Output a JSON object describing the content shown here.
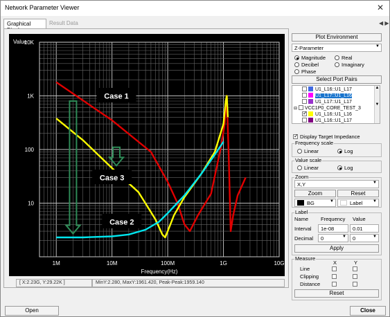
{
  "window": {
    "title": "Network Parameter Viewer",
    "close_glyph": "✕"
  },
  "tabs": [
    {
      "label": "Graphical Display",
      "active": true
    },
    {
      "label": "Result Data",
      "active": false
    }
  ],
  "tab_nav": "◀ ▶",
  "chart_data": {
    "type": "line",
    "ylabel": "Value",
    "xlabel": "Frequency(Hz)",
    "x_scale": "log",
    "y_scale": "log",
    "xlim": [
      500000,
      10000000000
    ],
    "ylim": [
      1,
      10000
    ],
    "x_ticks": [
      "1M",
      "10M",
      "100M",
      "1G",
      "10G"
    ],
    "y_ticks": [
      "10K",
      "1K",
      "100",
      "10"
    ],
    "grid": true,
    "series": [
      {
        "color": "#e00000",
        "x": [
          1000000,
          10000000,
          50000000,
          100000000,
          150000000,
          200000000,
          250000000,
          350000000,
          600000000,
          900000000,
          1050000000,
          1150000000,
          1250000000,
          1350000000,
          1500000000,
          1800000000,
          2500000000
        ],
        "y": [
          1800,
          350,
          90,
          25,
          10,
          4,
          3,
          6,
          15,
          110,
          300,
          1000,
          60,
          3,
          6,
          14,
          30
        ]
      },
      {
        "color": "#ffff00",
        "x": [
          1000000,
          3000000,
          10000000,
          30000000,
          60000000,
          80000000,
          90000000,
          100000000,
          130000000,
          200000000,
          400000000,
          700000000,
          1000000000,
          1100000000,
          1150000000,
          1200000000
        ],
        "y": [
          380,
          150,
          45,
          16,
          5,
          2.6,
          2.3,
          3,
          6,
          13,
          35,
          90,
          300,
          800,
          1000,
          400
        ]
      },
      {
        "color": "#00e5ee",
        "x": [
          1000000,
          3000000,
          10000000,
          20000000,
          40000000,
          70000000,
          100000000,
          200000000,
          400000000,
          700000000,
          1000000000
        ],
        "y": [
          2.3,
          2.3,
          2.4,
          2.6,
          3.2,
          4.5,
          6.5,
          14,
          35,
          80,
          140
        ]
      }
    ],
    "annotations": [
      {
        "text": "Case 1",
        "x": 12000000,
        "y": 1000
      },
      {
        "text": "Case 3",
        "x": 10000000,
        "y": 30
      },
      {
        "text": "Case 2",
        "x": 15000000,
        "y": 4.5
      }
    ],
    "arrows": [
      {
        "x": 2000000,
        "y_from": 800,
        "y_to": 2.7
      },
      {
        "x": 12000000,
        "y_from": 110,
        "y_to": 50
      }
    ]
  },
  "status": {
    "coords": "[ X:2.23G, Y:29.22K ]",
    "stats": "MinY:2.280, MaxY:1961.420, Peak-Peak:1959.140"
  },
  "buttons": {
    "open": "Open",
    "close": "Close"
  },
  "right_panel": {
    "plot_environment": "Plot Environment",
    "param_select": "Z-Parameter",
    "display_modes": [
      {
        "label": "Magnitude",
        "checked": true
      },
      {
        "label": "Real",
        "checked": false
      },
      {
        "label": "Decibel",
        "checked": false
      },
      {
        "label": "Imaginary",
        "checked": false
      },
      {
        "label": "Phase",
        "checked": false
      }
    ],
    "select_port_pairs": "Select Port Pairs",
    "tree_items": [
      {
        "label": "U1_L16::U1_L17",
        "color": "#4169e1",
        "checked": false,
        "selected": false,
        "indent": 1
      },
      {
        "label": "U1_L17::U1_L16",
        "color": "#ff00ff",
        "checked": false,
        "selected": true,
        "indent": 1
      },
      {
        "label": "U1_L17::U1_L17",
        "color": "#9932cc",
        "checked": false,
        "selected": false,
        "indent": 1
      },
      {
        "label": "VCC1P0_CORE_TEST_3",
        "color": "",
        "checked": false,
        "selected": false,
        "indent": 0
      },
      {
        "label": "U1_L16::U1_L16",
        "color": "#ffff00",
        "checked": true,
        "selected": false,
        "indent": 1
      },
      {
        "label": "U1_L16::U1_L17",
        "color": "#800080",
        "checked": false,
        "selected": false,
        "indent": 1
      }
    ],
    "display_target_impedance": {
      "label": "Display Target Impedance",
      "checked": true
    },
    "frequency_scale": {
      "title": "Frequency scale",
      "linear": "Linear",
      "log": "Log",
      "selected": "log"
    },
    "value_scale": {
      "title": "Value scale",
      "linear": "Linear",
      "log": "Log",
      "selected": "log"
    },
    "zoom": {
      "title": "Zoom",
      "select": "X,Y",
      "zoom_btn": "Zoom",
      "reset_btn": "Reset",
      "bg": "BG",
      "label": "Label"
    },
    "label_group": {
      "title": "Label",
      "col_name": "Name",
      "col_freq": "Frequency",
      "col_value": "Value",
      "interval": "Interval",
      "interval_freq": "1e-08",
      "interval_value": "0.01",
      "decimal": "Decimal",
      "decimal_freq": "0",
      "decimal_value": "0",
      "apply": "Apply"
    },
    "measure": {
      "title": "Measure",
      "col_x": "X",
      "col_y": "Y",
      "rows": [
        "Line",
        "Clipping",
        "Distance"
      ],
      "reset": "Reset"
    }
  }
}
